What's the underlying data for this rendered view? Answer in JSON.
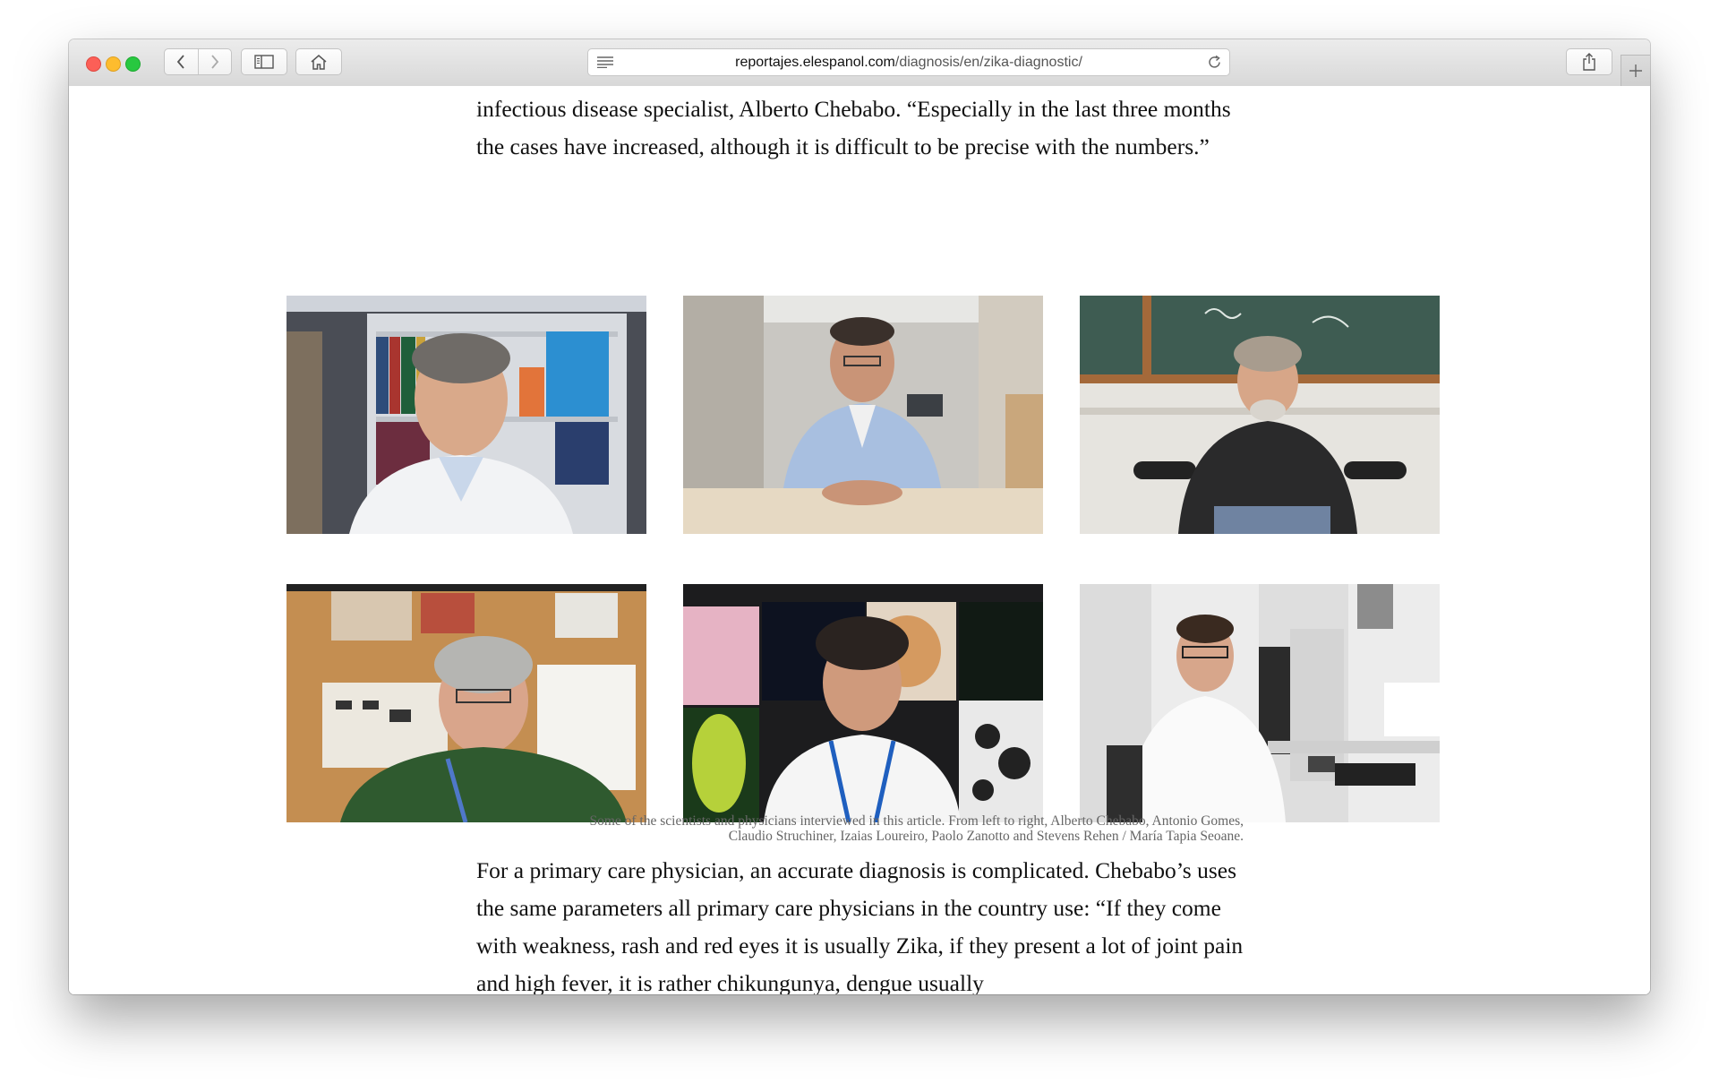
{
  "browser": {
    "url_host": "reportajes.elespanol.com",
    "url_path": "/diagnosis/en/zika-diagnostic/",
    "icons": [
      "back-icon",
      "forward-icon",
      "sidebar-icon",
      "home-icon",
      "reader-icon",
      "reload-icon",
      "share-icon",
      "plus-icon"
    ]
  },
  "article": {
    "paragraph_top": "infectious disease specialist, Alberto Chebabo. “Especially in the last three months the cases have increased, although it is difficult to be precise with the numbers.”",
    "caption_line1": "Some of the scientists and physicians interviewed in this article. From left to right, Alberto Chebabo, Antonio Gomes,",
    "caption_line2": "Claudio Struchiner, Izaias Loureiro, Paolo Zanotto and Stevens Rehen / María Tapia Seoane.",
    "paragraph_bottom": "For a primary care physician, an accurate diagnosis is complicated. Chebabo’s uses the same parameters all primary care physicians in the country use: “If they come with weakness, rash and red eyes it is usually Zika, if they present a lot of joint pain and high fever, it is rather chikungunya, dengue usually"
  }
}
